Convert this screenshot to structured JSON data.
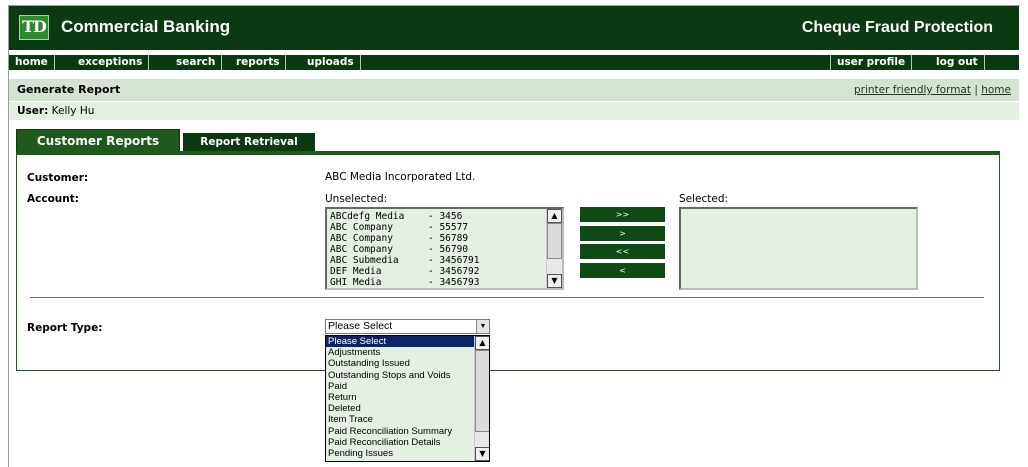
{
  "header": {
    "logo_text": "TD",
    "app_title": "Commercial Banking",
    "product_title": "Cheque Fraud Protection",
    "brand_dark": "#0b3a12",
    "brand_green": "#2d8a2b"
  },
  "nav": {
    "left": [
      "home",
      "exceptions",
      "search",
      "reports",
      "uploads"
    ],
    "right": [
      "user profile",
      "log out"
    ]
  },
  "titlebar": {
    "title": "Generate Report",
    "link_printer": "printer friendly format",
    "separator": "|",
    "link_home": "home"
  },
  "user": {
    "label": "User:",
    "name": "Kelly Hu"
  },
  "tabs": {
    "active": "Customer Reports",
    "inactive": "Report Retrieval"
  },
  "form": {
    "customer_label": "Customer:",
    "customer_value": "ABC Media Incorporated Ltd.",
    "account_label": "Account:",
    "unselected_label": "Unselected:",
    "selected_label": "Selected:",
    "accounts": [
      {
        "name": "ABCdefg Media",
        "number": "3456"
      },
      {
        "name": "ABC Company",
        "number": "55577"
      },
      {
        "name": "ABC Company",
        "number": "56789"
      },
      {
        "name": "ABC Company",
        "number": "56790"
      },
      {
        "name": "ABC Submedia",
        "number": "3456791"
      },
      {
        "name": "DEF Media",
        "number": "3456792"
      },
      {
        "name": "GHI Media",
        "number": "3456793"
      }
    ],
    "buttons": {
      "add_all": ">>",
      "add": ">",
      "remove_all": "<<",
      "remove": "<"
    },
    "report_type_label": "Report Type:",
    "report_type_value": "Please Select",
    "report_type_options": [
      "Please Select",
      "Adjustments",
      "Outstanding Issued",
      "Outstanding Stops and Voids",
      "Paid",
      "Return",
      "Deleted",
      "Item Trace",
      "Paid Reconciliation Summary",
      "Paid Reconciliation Details",
      "Pending Issues"
    ]
  }
}
